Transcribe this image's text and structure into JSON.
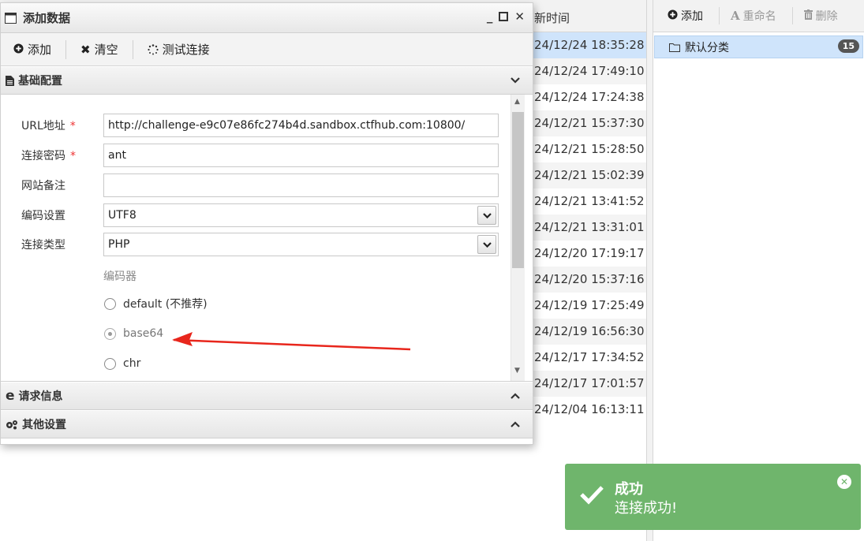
{
  "list": {
    "header": "新时间",
    "rows": [
      "24/12/24 18:35:28",
      "24/12/24 17:49:10",
      "24/12/24 17:24:38",
      "24/12/21 15:37:30",
      "24/12/21 15:28:50",
      "24/12/21 15:02:39",
      "24/12/21 13:41:52",
      "24/12/21 13:31:01",
      "24/12/20 17:19:17",
      "24/12/20 15:37:16",
      "24/12/19 17:25:49",
      "24/12/19 16:56:30",
      "24/12/17 17:34:52",
      "24/12/17 17:01:57",
      "24/12/04 16:13:11"
    ]
  },
  "category_panel": {
    "add_label": "添加",
    "rename_label": "重命名",
    "delete_label": "删除",
    "category_name": "默认分类",
    "category_count": "15"
  },
  "dialog": {
    "title": "添加数据",
    "toolbar": {
      "add_label": "添加",
      "clear_label": "清空",
      "test_label": "测试连接"
    },
    "sections": {
      "basic": "基础配置",
      "request": "请求信息",
      "other": "其他设置"
    },
    "form": {
      "url_label": "URL地址",
      "url_value": "http://challenge-e9c07e86fc274b4d.sandbox.ctfhub.com:10800/",
      "password_label": "连接密码",
      "password_value": "ant",
      "note_label": "网站备注",
      "note_value": "",
      "encoding_label": "编码设置",
      "encoding_value": "UTF8",
      "type_label": "连接类型",
      "type_value": "PHP",
      "required_mark": "*"
    },
    "encoder": {
      "title": "编码器",
      "options": [
        "default (不推荐)",
        "base64",
        "chr"
      ],
      "selected": "base64"
    }
  },
  "toast": {
    "title": "成功",
    "message": "连接成功!",
    "color": "#6fb56c"
  }
}
